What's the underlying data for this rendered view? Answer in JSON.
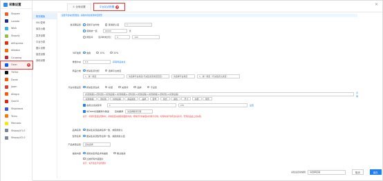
{
  "header": {
    "title": "采集设置",
    "close": "×"
  },
  "sidebar": {
    "items": [
      {
        "label": "Shopee",
        "color": "#f15a29"
      },
      {
        "label": "Lazada",
        "color": "#1b2b8c"
      },
      {
        "label": "Wish",
        "color": "#2fb7ec"
      },
      {
        "label": "Shopify",
        "color": "#95bf47"
      },
      {
        "label": "AliExpress",
        "color": "#e62e04"
      },
      {
        "label": "Alibaba",
        "color": "#ff6a00"
      },
      {
        "label": "Coupang",
        "color": "#c9252c"
      },
      {
        "label": "Ozon",
        "color": "#005bff"
      },
      {
        "label": "TikTok",
        "color": "#111111"
      },
      {
        "label": "Daraz",
        "color": "#f85606"
      },
      {
        "label": "Joom",
        "color": "#e53935"
      },
      {
        "label": "Allegro",
        "color": "#ff5a00"
      },
      {
        "label": "Qoo10",
        "color": "#e2231a"
      },
      {
        "label": "Shoplazza",
        "color": "#3b5bdb"
      },
      {
        "label": "Temu",
        "color": "#fb7701"
      },
      {
        "label": "Mercado",
        "color": "#ffe600"
      },
      {
        "label": "ShoppyV1.0",
        "color": "#7a8899"
      },
      {
        "label": "ShoppyV2.0",
        "color": "#7a8899"
      }
    ],
    "active_index": 7,
    "active_badge": "1"
  },
  "tabs": [
    {
      "label": "① 全局设置"
    },
    {
      "label": "平台站点配置",
      "badge": "2"
    }
  ],
  "subnav": [
    "物流模版",
    "SKU变种",
    "库存价格",
    "发货设置",
    "平台分类",
    "图片设置",
    "描述设置",
    "其他设置"
  ],
  "tip": "设置平台站点配置后，采集时直接使用对应配置",
  "form": {
    "shipping": {
      "label": "发货期设置",
      "opt1": "使用平台时效",
      "opt1_hint": "使用默认值",
      "opt2": "使用统一值",
      "opt2_value": "10000",
      "opt2_unit": "天",
      "opt3": "按区间",
      "opt3_range": "区间时效(天)：",
      "opt3_a": "0",
      "opt3_b": "100"
    },
    "vat": {
      "label": "VAT税率",
      "opt1": "免税",
      "opt2": "10%",
      "opt3": "20%"
    },
    "weight": {
      "label": "重量(kg)",
      "value": "0.5",
      "link": "获取商品信息"
    },
    "category": {
      "label": "商品分类",
      "opt": "按采集源分配",
      "sel1": "选择平台类目",
      "sel2": "1、统一类目",
      "sel2_hint": "请选择平台类目(与采集来源类目匹配)",
      "sel3": "请选择平台类目",
      "sel4": "1、统一类目（可采集默认类目）"
    },
    "title": {
      "label": "平台标题设置",
      "opt1": "按采集源生成",
      "opt2": "标题",
      "opt3": "关键词",
      "opt4": "品牌",
      "opt5": "不设置",
      "text": "[标题前缀]+[原标题]+[标题后缀]+[标题前缀]+[原标题]+[标题后缀]+[标题前缀]+[原标题]+[标题后缀]",
      "link": "示例"
    },
    "tags": [
      "标题前缀",
      "原标题",
      "标题后缀",
      "商品属性",
      "品牌",
      "型号",
      "款式",
      "颜色",
      "尺寸",
      "材质",
      "场景"
    ],
    "limit": {
      "opt": "启用过滤关键词",
      "from": "0",
      "to": "255",
      "link": "设置"
    },
    "translate": {
      "opt": "将Ozon标题翻译为俄语",
      "hint": "自动翻译",
      "sel": "请选择翻译引擎"
    },
    "warning": "提示：标题长度超过限制时，系统会自动截取前面的内容；特殊字符将被自动替换为空格；标题内容不得包含违禁词，否则商品会上架失败。",
    "brand": {
      "label": "品牌名称",
      "value": "跟采集来源品牌名称一致，或使用默认"
    },
    "model": {
      "label": "型号名称",
      "value": "跟采集来源型号名称一致，或使用默认值"
    },
    "product_type": {
      "label": "产品类型设置",
      "value": "自动选择"
    },
    "desc": {
      "label": "描述内容",
      "opt1": "使用采集商品详情描述",
      "opt2": "跳过描述",
      "chk": "过滤所有外链图片",
      "warning": "提示：将不会显示任何图片"
    }
  },
  "footer": {
    "label": "采集后自动编辑",
    "select": "请选择店铺",
    "cancel": "取消",
    "save": "保存"
  }
}
